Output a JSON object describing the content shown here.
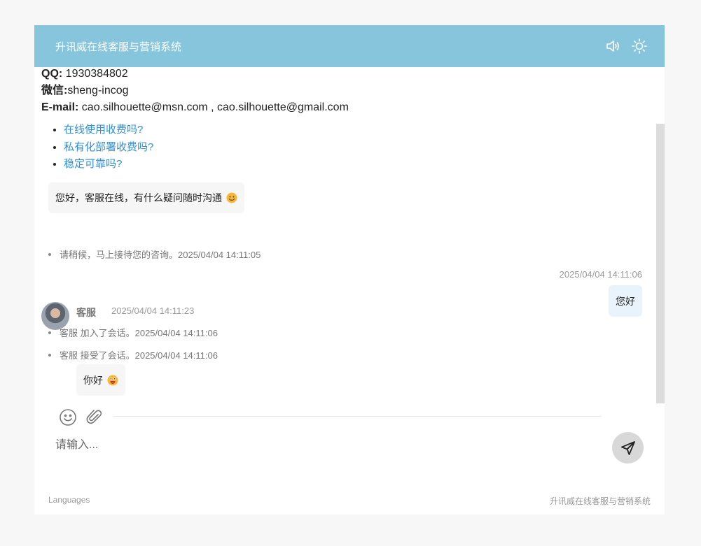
{
  "header": {
    "title": "升讯威在线客服与营销系统",
    "icons": [
      "volume-icon",
      "sun-icon"
    ]
  },
  "contact": {
    "qq_label": "QQ:",
    "qq_value": "1930384802",
    "wechat_label": "微信:",
    "wechat_value": "sheng-incog",
    "email_label": "E-mail:",
    "email_value": "cao.silhouette@msn.com , cao.silhouette@gmail.com"
  },
  "faq": [
    "在线使用收费吗?",
    "私有化部署收费吗?",
    "稳定可靠吗?"
  ],
  "messages": {
    "welcome": "您好，客服在线，有什么疑问随时沟通",
    "sys1": "请稍候，马上接待您的咨询。2025/04/04 14:11:05",
    "my_time": "2025/04/04 14:11:06",
    "my_text": "您好",
    "sys2": "客服 加入了会话。2025/04/04 14:11:06",
    "sys3": "客服 接受了会话。2025/04/04 14:11:06",
    "agent_name": "客服",
    "agent_time": "2025/04/04 14:11:23",
    "agent_text": "你好"
  },
  "composer": {
    "placeholder": "请输入..."
  },
  "footer": {
    "languages": "Languages",
    "brand": "升讯威在线客服与营销系统"
  },
  "colors": {
    "header_bg": "#86c5dc",
    "link": "#2f8fd8"
  }
}
